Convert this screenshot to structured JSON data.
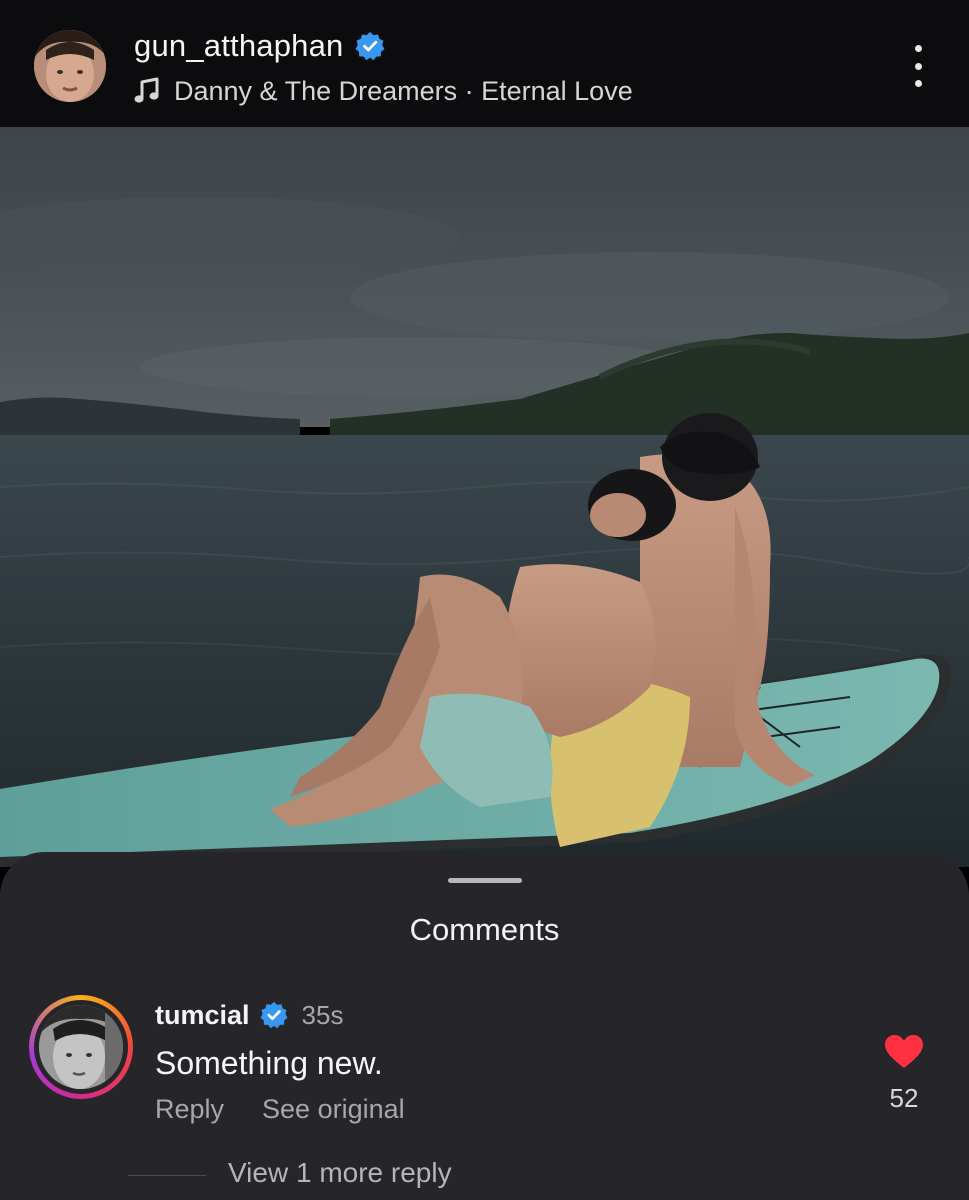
{
  "header": {
    "username": "gun_atthaphan",
    "verified": true,
    "music": {
      "icon": "music-note-icon",
      "text": "Danny & The Dreamers · Eternal Love"
    },
    "more_icon": "more-vertical-icon"
  },
  "comments_sheet": {
    "title": "Comments",
    "comments": [
      {
        "username": "tumcial",
        "verified": true,
        "time": "35s",
        "text": "Something new.",
        "reply_label": "Reply",
        "see_original_label": "See original",
        "like_icon": "heart-icon",
        "like_count": "52",
        "view_replies_label": "View 1 more reply"
      }
    ]
  },
  "colors": {
    "verified_blue": "#3897f0",
    "like_red": "#ff3040",
    "sheet_background": "#25252a"
  }
}
